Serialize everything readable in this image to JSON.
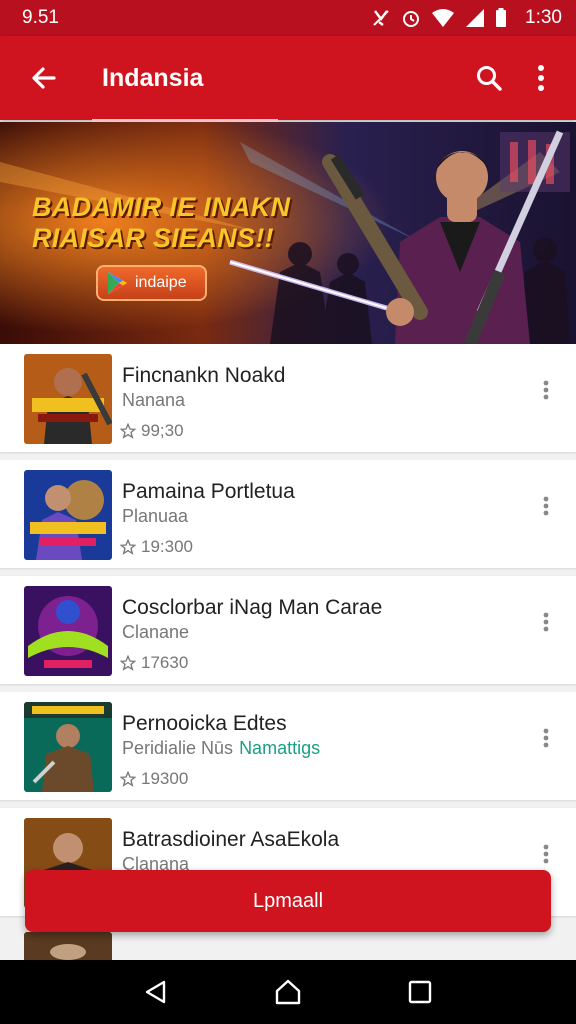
{
  "status_bar": {
    "time_left": "9.51",
    "time_right": "1:30"
  },
  "app_bar": {
    "title": "Indansia"
  },
  "banner": {
    "headline_line1": "BADAMIR IE INAKN",
    "headline_line2": "RIAISAR SIEANS!!",
    "button_label": "indaipe"
  },
  "list": [
    {
      "title": "Fincnankn Noakd",
      "subtitle": "Nanana",
      "accent": "",
      "rating": "99;30"
    },
    {
      "title": "Pamaina Portletua",
      "subtitle": "Planuaa",
      "accent": "",
      "rating": "19:300"
    },
    {
      "title": "Cosclorbar iNag Man Carae",
      "subtitle": "Clanane",
      "accent": "",
      "rating": "17630"
    },
    {
      "title": "Pernooicka Edtes",
      "subtitle": "Peridialie Nūs",
      "accent": "Namattigs",
      "rating": "19300"
    },
    {
      "title": "Batrasdioiner AsaEkola",
      "subtitle": "Clanana",
      "accent": "",
      "rating": ""
    }
  ],
  "cta": {
    "label": "Lpmaall"
  },
  "colors": {
    "primary": "#d0141f",
    "status_bar": "#b8101e",
    "accent_text": "#1a9e86"
  },
  "icons": [
    "arrow-back-icon",
    "search-icon",
    "more-vert-icon",
    "star-outline-icon",
    "play-store-icon",
    "nav-back-icon",
    "nav-home-icon",
    "nav-recents-icon"
  ]
}
